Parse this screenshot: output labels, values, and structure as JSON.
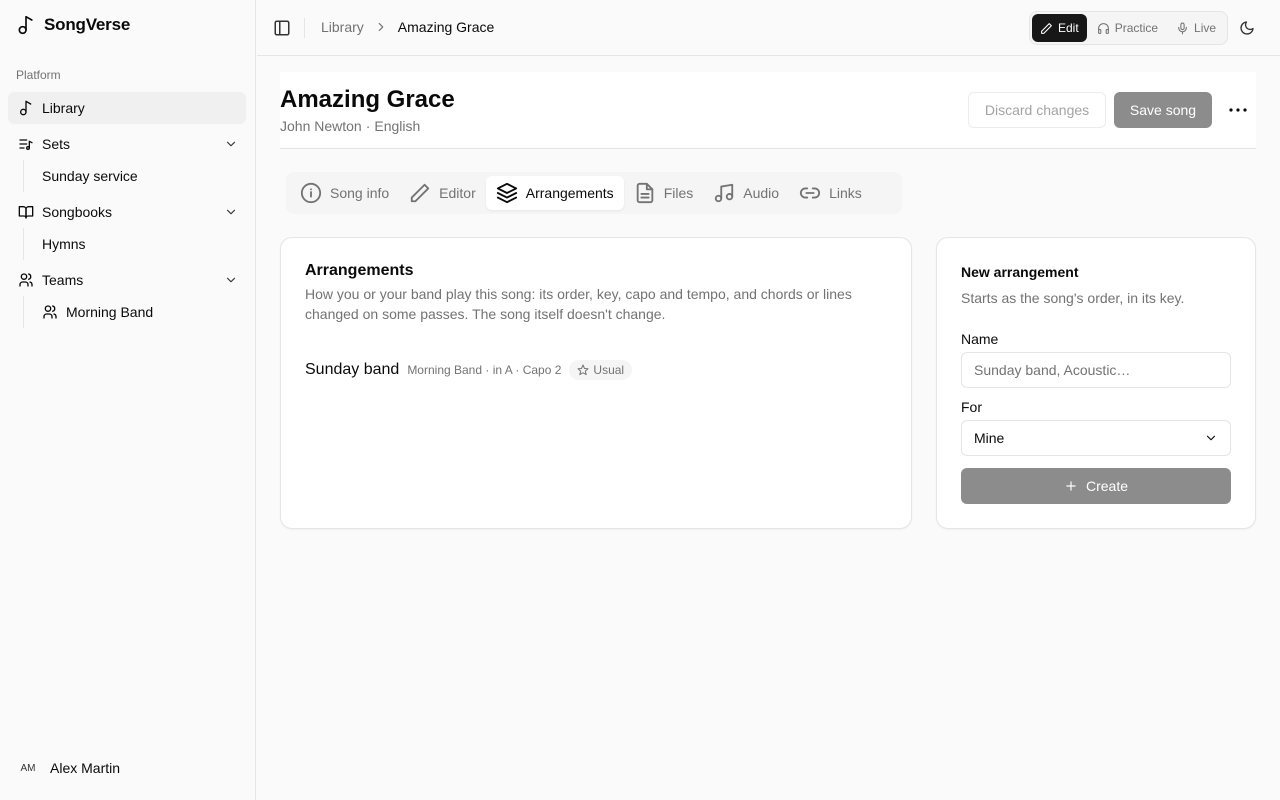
{
  "app": {
    "name": "SongVerse"
  },
  "sidebar": {
    "group_label": "Platform",
    "items": [
      {
        "label": "Library"
      },
      {
        "label": "Sets",
        "children": [
          "Sunday service"
        ]
      },
      {
        "label": "Songbooks",
        "children": [
          "Hymns"
        ]
      },
      {
        "label": "Teams",
        "children": [
          "Morning Band"
        ]
      }
    ],
    "user": {
      "initials": "AM",
      "name": "Alex Martin"
    }
  },
  "topbar": {
    "breadcrumb": [
      "Library",
      "Amazing Grace"
    ],
    "modes": [
      "Edit",
      "Practice",
      "Live"
    ],
    "active_mode": "Edit"
  },
  "song": {
    "title": "Amazing Grace",
    "author": "John Newton",
    "separator": "·",
    "language": "English"
  },
  "actions": {
    "discard": "Discard changes",
    "save": "Save song"
  },
  "tabs": [
    {
      "label": "Song info",
      "icon": "info-icon"
    },
    {
      "label": "Editor",
      "icon": "pencil-icon"
    },
    {
      "label": "Arrangements",
      "icon": "layers-icon"
    },
    {
      "label": "Files",
      "icon": "file-icon"
    },
    {
      "label": "Audio",
      "icon": "music-icon"
    },
    {
      "label": "Links",
      "icon": "link-icon"
    }
  ],
  "active_tab": "Arrangements",
  "arrangements": {
    "title": "Arrangements",
    "description": "How you or your band play this song: its order, key, capo and tempo, and chords or lines changed on some passes. The song itself doesn't change.",
    "items": [
      {
        "name": "Sunday band",
        "meta": "Morning Band · in A · Capo 2",
        "badge": "Usual"
      }
    ]
  },
  "new_arrangement": {
    "title": "New arrangement",
    "description": "Starts as the song's order, in its key.",
    "name_label": "Name",
    "name_placeholder": "Sunday band, Acoustic…",
    "for_label": "For",
    "for_value": "Mine",
    "create_label": "Create"
  }
}
